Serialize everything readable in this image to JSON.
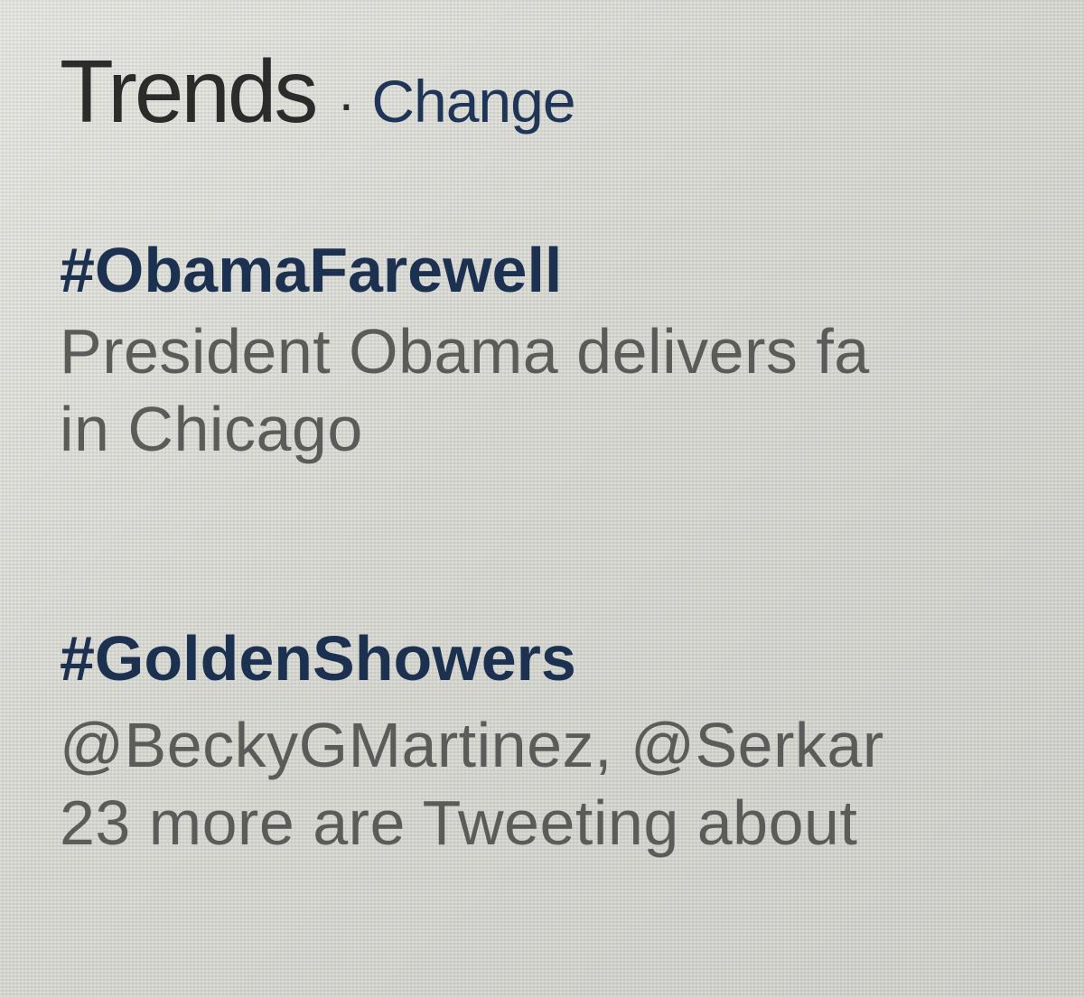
{
  "trends_module": {
    "title": "Trends",
    "separator": "·",
    "change_label": "Change",
    "items": [
      {
        "hashtag": "#ObamaFarewell",
        "description_lines": [
          "President Obama delivers fa",
          "in Chicago"
        ]
      },
      {
        "hashtag": "#GoldenShowers",
        "description_lines": [
          "@BeckyGMartinez, @Serkar",
          "23 more are Tweeting about"
        ]
      }
    ]
  },
  "colors": {
    "link": "#1c3050",
    "title": "#1d1d1d",
    "secondary_text": "#5b5c5a",
    "screen_background": "#d8d9d3"
  }
}
